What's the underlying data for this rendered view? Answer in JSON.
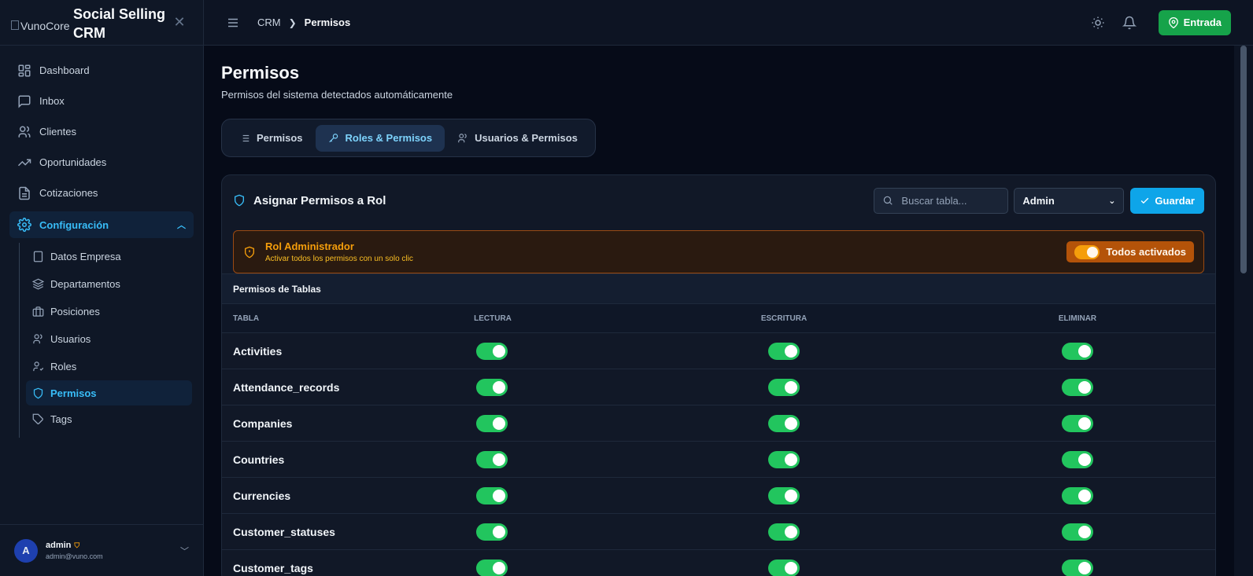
{
  "brand": {
    "logo_text": "VunoCore",
    "title": "Social Selling CRM"
  },
  "sidebar": {
    "items": [
      {
        "label": "Dashboard",
        "icon": "dashboard-icon"
      },
      {
        "label": "Inbox",
        "icon": "inbox-icon"
      },
      {
        "label": "Clientes",
        "icon": "users-icon"
      },
      {
        "label": "Oportunidades",
        "icon": "trending-icon"
      },
      {
        "label": "Cotizaciones",
        "icon": "document-icon"
      }
    ],
    "config": {
      "label": "Configuración",
      "icon": "gear-icon"
    },
    "subitems": [
      {
        "label": "Datos Empresa",
        "icon": "building-icon"
      },
      {
        "label": "Departamentos",
        "icon": "layers-icon"
      },
      {
        "label": "Posiciones",
        "icon": "briefcase-icon"
      },
      {
        "label": "Usuarios",
        "icon": "users-icon"
      },
      {
        "label": "Roles",
        "icon": "user-check-icon"
      },
      {
        "label": "Permisos",
        "icon": "shield-icon",
        "active": true
      },
      {
        "label": "Tags",
        "icon": "tag-icon"
      }
    ],
    "user": {
      "initial": "A",
      "name": "admin",
      "email": "admin@vuno.com"
    }
  },
  "topbar": {
    "breadcrumb": [
      "CRM",
      "Permisos"
    ],
    "entrada_label": "Entrada"
  },
  "page": {
    "title": "Permisos",
    "subtitle": "Permisos del sistema detectados automáticamente",
    "tabs": [
      {
        "label": "Permisos",
        "icon": "list-icon"
      },
      {
        "label": "Roles & Permisos",
        "icon": "key-icon",
        "active": true
      },
      {
        "label": "Usuarios & Permisos",
        "icon": "users-icon"
      }
    ]
  },
  "card": {
    "title": "Asignar Permisos a Rol",
    "search_placeholder": "Buscar tabla...",
    "role_selected": "Admin",
    "save_label": "Guardar",
    "banner": {
      "title": "Rol Administrador",
      "subtitle": "Activar todos los permisos con un solo clic",
      "toggle_label": "Todos activados"
    },
    "section_title": "Permisos de Tablas",
    "columns": [
      "TABLA",
      "LECTURA",
      "ESCRITURA",
      "ELIMINAR"
    ],
    "rows": [
      {
        "name": "Activities",
        "read": true,
        "write": true,
        "delete": true
      },
      {
        "name": "Attendance_records",
        "read": true,
        "write": true,
        "delete": true
      },
      {
        "name": "Companies",
        "read": true,
        "write": true,
        "delete": true
      },
      {
        "name": "Countries",
        "read": true,
        "write": true,
        "delete": true
      },
      {
        "name": "Currencies",
        "read": true,
        "write": true,
        "delete": true
      },
      {
        "name": "Customer_statuses",
        "read": true,
        "write": true,
        "delete": true
      },
      {
        "name": "Customer_tags",
        "read": true,
        "write": true,
        "delete": true
      }
    ]
  },
  "colors": {
    "accent": "#38bdf8",
    "success": "#22c55e",
    "warning": "#f59e0b",
    "background": "#060b18"
  }
}
